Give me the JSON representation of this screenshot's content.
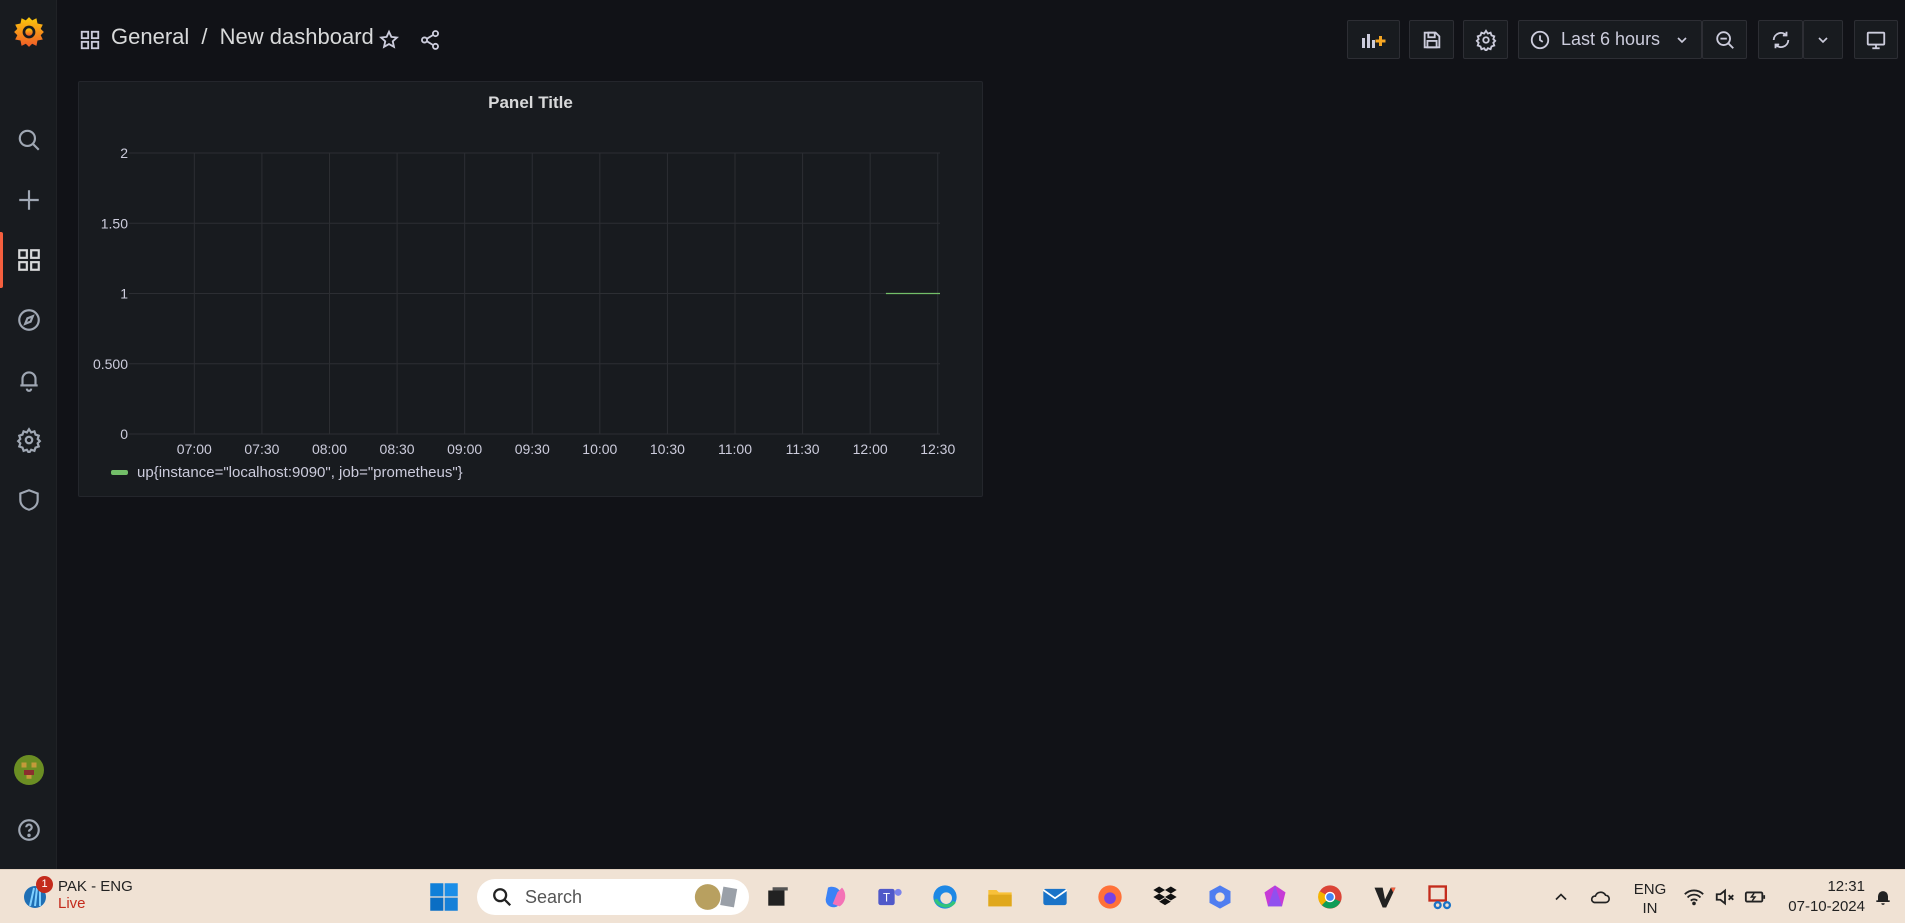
{
  "breadcrumb": {
    "folder": "General",
    "separator": "/",
    "dashboard": "New dashboard"
  },
  "toolbar": {
    "time_range": "Last 6 hours"
  },
  "panel": {
    "title": "Panel Title",
    "legend": "up{instance=\"localhost:9090\", job=\"prometheus\"}"
  },
  "chart_data": {
    "type": "line",
    "title": "Panel Title",
    "xlabel": "",
    "ylabel": "",
    "x_ticks": [
      "07:00",
      "07:30",
      "08:00",
      "08:30",
      "09:00",
      "09:30",
      "10:00",
      "10:30",
      "11:00",
      "11:30",
      "12:00",
      "12:30"
    ],
    "y_ticks": [
      "0",
      "0.500",
      "1",
      "1.50",
      "2"
    ],
    "ylim": [
      0,
      2
    ],
    "xlim": [
      "06:31",
      "12:31"
    ],
    "grid": true,
    "legend_position": "bottom-left",
    "series": [
      {
        "name": "up{instance=\"localhost:9090\", job=\"prometheus\"}",
        "color": "#73bf69",
        "x": [
          "12:07",
          "12:31"
        ],
        "values": [
          1,
          1
        ]
      }
    ]
  },
  "colors": {
    "accent": "#f55f3e",
    "series": "#73bf69",
    "background": "#111217",
    "panel": "#181b1f"
  },
  "taskbar": {
    "weather_badge": "1",
    "weather_line1": "PAK - ENG",
    "weather_line2": "Live",
    "search_placeholder": "Search",
    "lang_line1": "ENG",
    "lang_line2": "IN",
    "time": "12:31",
    "date": "07-10-2024"
  }
}
